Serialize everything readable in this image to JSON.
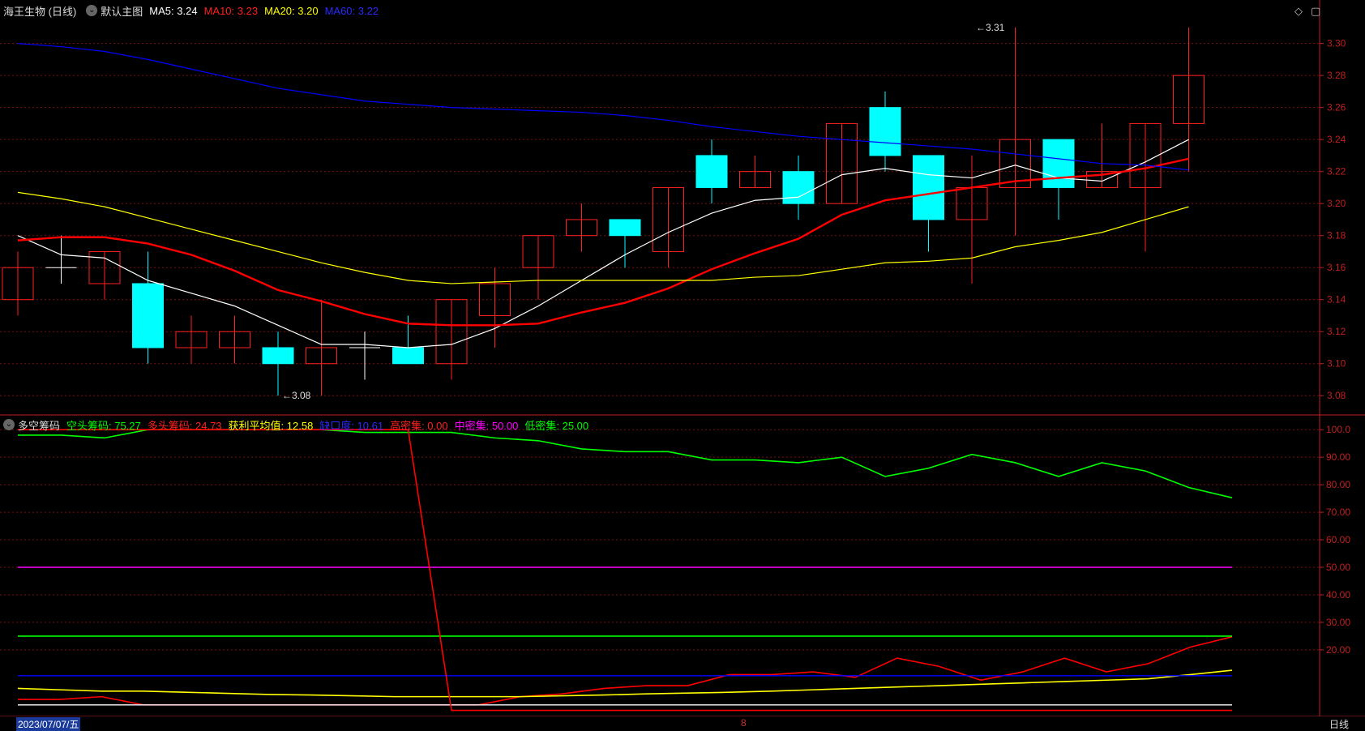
{
  "main_header": {
    "title": "海王生物 (日线)",
    "subtitle": "默认主图",
    "ma5": "MA5: 3.24",
    "ma10": "MA10: 3.23",
    "ma20": "MA20: 3.20",
    "ma60": "MA60: 3.22"
  },
  "indicator_header": {
    "name": "多空筹码",
    "short_chips": "空头筹码: 75.27",
    "long_chips": "多头筹码: 24.73",
    "avg_profit": "获利平均值: 12.58",
    "gap": "缺口度: 10.61",
    "high_dense": "高密集: 0.00",
    "mid_dense": "中密集: 50.00",
    "low_dense": "低密集: 25.00"
  },
  "controls": {
    "diamond": "◇",
    "window": "▢"
  },
  "bottom_bar": {
    "date": "2023/07/07/五",
    "marker": "8",
    "period": "日线"
  },
  "colors": {
    "up": "#ff2020",
    "down": "#00ffff",
    "ma5": "#ffffff",
    "ma10": "#ff0000",
    "ma20": "#ffff00",
    "ma60": "#0000ff",
    "short": "#00ff00",
    "long": "#ff0000",
    "avg": "#ffff00",
    "gap": "#0000ff",
    "high": "#ffffff",
    "mid": "#ff00ff",
    "low": "#00ff00",
    "axis": "#c02020",
    "grid": "#7a1010"
  },
  "chart_data": [
    {
      "type": "candlestick",
      "title": "海王生物 (日线)",
      "ylim": [
        3.07,
        3.315
      ],
      "yticks": [
        "3.08",
        "3.10",
        "3.12",
        "3.14",
        "3.16",
        "3.18",
        "3.20",
        "3.22",
        "3.24",
        "3.26",
        "3.28",
        "3.30"
      ],
      "annotations": [
        {
          "text": "3.31",
          "index": 22,
          "value": 3.31
        },
        {
          "text": "3.08",
          "index": 6,
          "value": 3.08
        }
      ],
      "candles": [
        {
          "o": 3.14,
          "h": 3.17,
          "l": 3.13,
          "c": 3.16
        },
        {
          "o": 3.16,
          "h": 3.18,
          "l": 3.15,
          "c": 3.16
        },
        {
          "o": 3.15,
          "h": 3.17,
          "l": 3.14,
          "c": 3.17
        },
        {
          "o": 3.15,
          "h": 3.17,
          "l": 3.1,
          "c": 3.11
        },
        {
          "o": 3.11,
          "h": 3.13,
          "l": 3.1,
          "c": 3.12
        },
        {
          "o": 3.11,
          "h": 3.13,
          "l": 3.1,
          "c": 3.12
        },
        {
          "o": 3.11,
          "h": 3.12,
          "l": 3.08,
          "c": 3.1
        },
        {
          "o": 3.1,
          "h": 3.14,
          "l": 3.08,
          "c": 3.11
        },
        {
          "o": 3.11,
          "h": 3.12,
          "l": 3.09,
          "c": 3.11
        },
        {
          "o": 3.11,
          "h": 3.13,
          "l": 3.1,
          "c": 3.1
        },
        {
          "o": 3.1,
          "h": 3.14,
          "l": 3.09,
          "c": 3.14
        },
        {
          "o": 3.13,
          "h": 3.16,
          "l": 3.11,
          "c": 3.15
        },
        {
          "o": 3.16,
          "h": 3.18,
          "l": 3.14,
          "c": 3.18
        },
        {
          "o": 3.18,
          "h": 3.2,
          "l": 3.17,
          "c": 3.19
        },
        {
          "o": 3.19,
          "h": 3.19,
          "l": 3.16,
          "c": 3.18
        },
        {
          "o": 3.17,
          "h": 3.21,
          "l": 3.16,
          "c": 3.21
        },
        {
          "o": 3.23,
          "h": 3.24,
          "l": 3.2,
          "c": 3.21
        },
        {
          "o": 3.21,
          "h": 3.23,
          "l": 3.21,
          "c": 3.22
        },
        {
          "o": 3.22,
          "h": 3.23,
          "l": 3.19,
          "c": 3.2
        },
        {
          "o": 3.2,
          "h": 3.25,
          "l": 3.2,
          "c": 3.25
        },
        {
          "o": 3.26,
          "h": 3.27,
          "l": 3.22,
          "c": 3.23
        },
        {
          "o": 3.23,
          "h": 3.23,
          "l": 3.17,
          "c": 3.19
        },
        {
          "o": 3.19,
          "h": 3.23,
          "l": 3.15,
          "c": 3.21
        },
        {
          "o": 3.21,
          "h": 3.31,
          "l": 3.18,
          "c": 3.24
        },
        {
          "o": 3.24,
          "h": 3.24,
          "l": 3.19,
          "c": 3.21
        },
        {
          "o": 3.21,
          "h": 3.25,
          "l": 3.21,
          "c": 3.22
        },
        {
          "o": 3.21,
          "h": 3.25,
          "l": 3.17,
          "c": 3.25
        },
        {
          "o": 3.25,
          "h": 3.31,
          "l": 3.22,
          "c": 3.28
        }
      ],
      "series": [
        {
          "name": "MA5",
          "values": [
            3.18,
            3.168,
            3.166,
            3.152,
            3.144,
            3.136,
            3.124,
            3.112,
            3.112,
            3.11,
            3.112,
            3.122,
            3.136,
            3.152,
            3.168,
            3.182,
            3.194,
            3.202,
            3.204,
            3.218,
            3.222,
            3.218,
            3.216,
            3.224,
            3.216,
            3.214,
            3.226,
            3.24
          ]
        },
        {
          "name": "MA10",
          "values": [
            3.177,
            3.179,
            3.179,
            3.175,
            3.168,
            3.158,
            3.146,
            3.139,
            3.131,
            3.125,
            3.124,
            3.124,
            3.125,
            3.132,
            3.138,
            3.147,
            3.159,
            3.169,
            3.178,
            3.193,
            3.202,
            3.206,
            3.21,
            3.214,
            3.216,
            3.218,
            3.222,
            3.228
          ]
        },
        {
          "name": "MA20",
          "values": [
            3.207,
            3.203,
            3.198,
            3.191,
            3.184,
            3.177,
            3.17,
            3.163,
            3.157,
            3.152,
            3.15,
            3.151,
            3.152,
            3.152,
            3.152,
            3.152,
            3.152,
            3.154,
            3.155,
            3.159,
            3.163,
            3.164,
            3.166,
            3.173,
            3.177,
            3.182,
            3.19,
            3.198
          ]
        },
        {
          "name": "MA60",
          "values": [
            3.3,
            3.298,
            3.295,
            3.29,
            3.284,
            3.278,
            3.272,
            3.268,
            3.264,
            3.262,
            3.26,
            3.259,
            3.258,
            3.257,
            3.255,
            3.252,
            3.248,
            3.245,
            3.242,
            3.24,
            3.238,
            3.236,
            3.234,
            3.231,
            3.228,
            3.225,
            3.224,
            3.221
          ]
        }
      ]
    },
    {
      "type": "line",
      "title": "多空筹码",
      "ylim": [
        -3,
        103
      ],
      "yticks": [
        "20.00",
        "30.00",
        "40.00",
        "50.00",
        "60.00",
        "70.00",
        "80.00",
        "90.00",
        "100.0"
      ],
      "series": [
        {
          "name": "空头筹码",
          "values": [
            98,
            98,
            97,
            100,
            100,
            100,
            100,
            100,
            99,
            99,
            99,
            97,
            96,
            93,
            92,
            92,
            89,
            89,
            88,
            90,
            83,
            86,
            91,
            88,
            83,
            88,
            85,
            79,
            75.27
          ]
        },
        {
          "name": "多头筹码",
          "values": [
            2,
            2,
            3,
            0,
            0,
            0,
            0,
            0,
            0,
            0,
            0,
            0,
            3,
            4,
            6,
            7,
            7,
            11,
            11,
            12,
            10,
            17,
            14,
            9,
            12,
            17,
            12,
            15,
            21,
            24.73
          ]
        },
        {
          "name": "获利平均值",
          "values": [
            6,
            5.5,
            5,
            5,
            4.6,
            4.2,
            3.8,
            3.6,
            3.3,
            3,
            3,
            3,
            3,
            3.3,
            3.6,
            4,
            4.3,
            4.6,
            5,
            5.5,
            6,
            6.5,
            7,
            7.5,
            8,
            8.5,
            9,
            9.5,
            11,
            12.58
          ]
        },
        {
          "name": "缺口度",
          "values": [
            10.61
          ]
        },
        {
          "name": "高密集",
          "values": [
            0.0
          ]
        },
        {
          "name": "中密集",
          "values": [
            50.0
          ]
        },
        {
          "name": "低密集",
          "values": [
            25.0
          ]
        }
      ]
    }
  ]
}
